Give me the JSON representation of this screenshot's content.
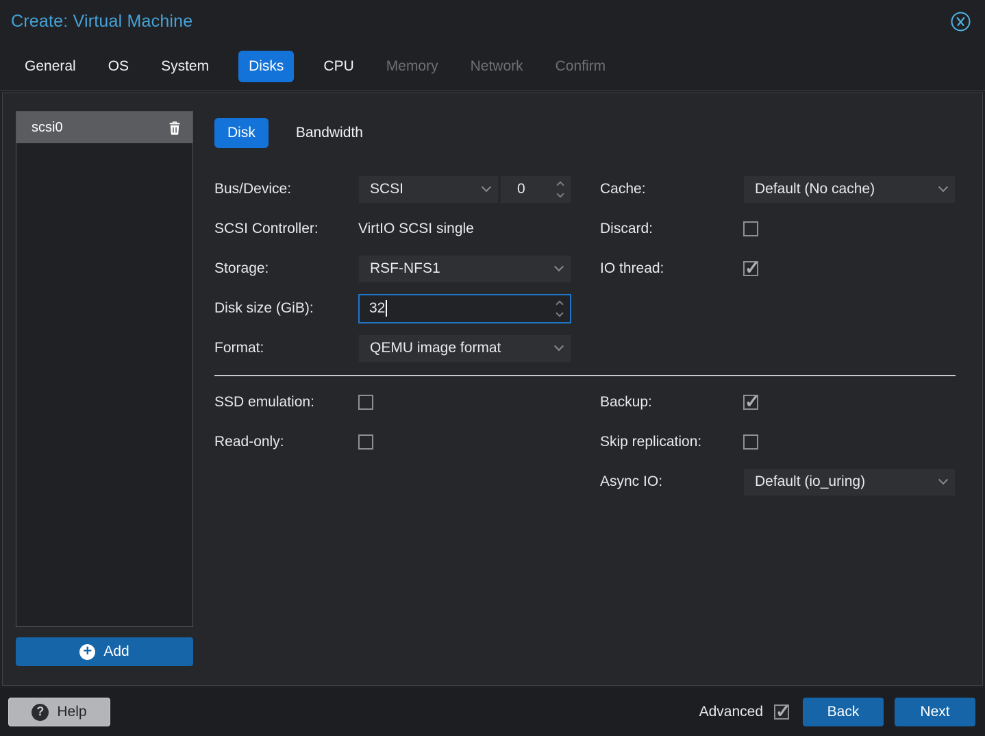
{
  "header": {
    "title": "Create: Virtual Machine",
    "close_icon": "circle-x-icon"
  },
  "wizard_tabs": {
    "items": [
      {
        "label": "General",
        "state": "enabled"
      },
      {
        "label": "OS",
        "state": "enabled"
      },
      {
        "label": "System",
        "state": "enabled"
      },
      {
        "label": "Disks",
        "state": "active"
      },
      {
        "label": "CPU",
        "state": "enabled"
      },
      {
        "label": "Memory",
        "state": "disabled"
      },
      {
        "label": "Network",
        "state": "disabled"
      },
      {
        "label": "Confirm",
        "state": "disabled"
      }
    ]
  },
  "disk_list": {
    "items": [
      {
        "label": "scsi0",
        "selected": true,
        "delete_icon": "trash-icon"
      }
    ],
    "add_button": {
      "label": "Add",
      "icon": "plus-circle-icon"
    }
  },
  "disk_form": {
    "tabs": [
      {
        "label": "Disk",
        "state": "active"
      },
      {
        "label": "Bandwidth",
        "state": "normal"
      }
    ],
    "bus_device": {
      "label": "Bus/Device:",
      "bus_value": "SCSI",
      "device_value": "0"
    },
    "scsi_controller": {
      "label": "SCSI Controller:",
      "value": "VirtIO SCSI single"
    },
    "storage": {
      "label": "Storage:",
      "value": "RSF-NFS1"
    },
    "disk_size": {
      "label": "Disk size (GiB):",
      "value": "32",
      "focused": true
    },
    "format": {
      "label": "Format:",
      "value": "QEMU image format"
    },
    "cache": {
      "label": "Cache:",
      "value": "Default (No cache)"
    },
    "discard": {
      "label": "Discard:",
      "checked": false
    },
    "io_thread": {
      "label": "IO thread:",
      "checked": true
    },
    "ssd_emulation": {
      "label": "SSD emulation:",
      "checked": false
    },
    "read_only": {
      "label": "Read-only:",
      "checked": false
    },
    "backup": {
      "label": "Backup:",
      "checked": true
    },
    "skip_replication": {
      "label": "Skip replication:",
      "checked": false
    },
    "async_io": {
      "label": "Async IO:",
      "value": "Default (io_uring)"
    }
  },
  "footer": {
    "help_button": {
      "label": "Help",
      "icon": "question-circle-icon"
    },
    "advanced": {
      "label": "Advanced",
      "checked": true
    },
    "back_button": {
      "label": "Back"
    },
    "next_button": {
      "label": "Next"
    }
  },
  "colors": {
    "title_blue": "#45a2d8",
    "close_icon_blue": "#4cb4e6",
    "tab_active_blue": "#1473d8",
    "button_blue": "#1565a8",
    "focus_border_blue": "#2077c9",
    "panel_bg": "#26272a",
    "field_bg": "#2f3034",
    "selected_item_bg": "#5b5c60",
    "footer_bg": "#1d1e21",
    "help_button_bg": "#b4b5b8",
    "separator_light": "#c9cacd"
  }
}
